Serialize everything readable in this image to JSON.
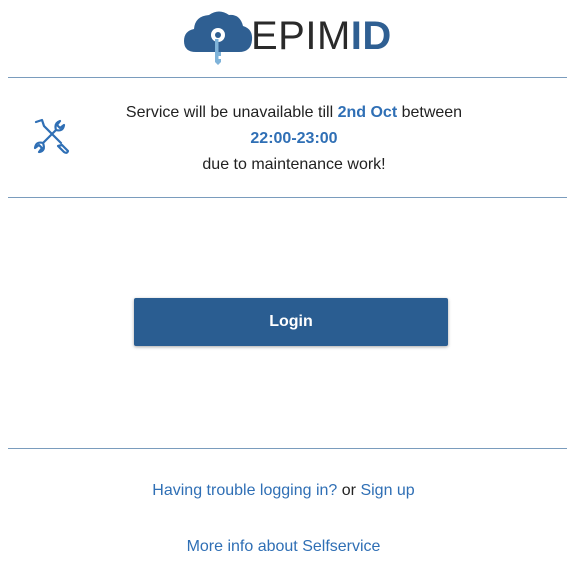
{
  "brand": {
    "name_part1": "EPIM",
    "name_part2": "ID",
    "logo_icon": "cloud-key-icon",
    "color_primary": "#2f5f92",
    "color_accent": "#2f6fb5"
  },
  "notice": {
    "icon": "wrench-screwdriver-icon",
    "text_before": "Service will be unavailable till ",
    "date": "2nd Oct",
    "text_after_date": " between",
    "time_window": "22:00-23:00",
    "text_end": "due to maintenance work!"
  },
  "login": {
    "button_label": "Login"
  },
  "footer": {
    "trouble_link": "Having trouble logging in?",
    "or_text": " or ",
    "signup_link": "Sign up",
    "more_info_link": "More info about Selfservice"
  }
}
